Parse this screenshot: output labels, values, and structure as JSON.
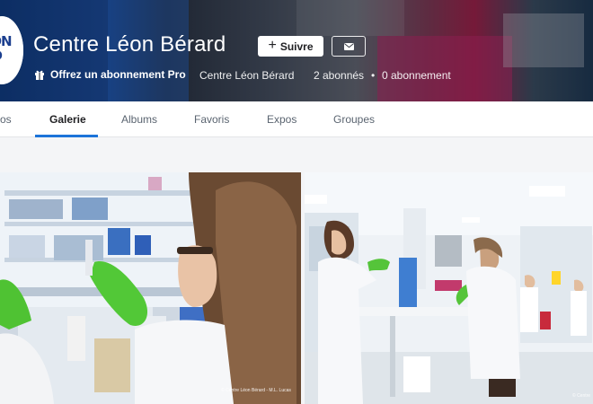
{
  "profile": {
    "avatar_text_line1": "EON",
    "avatar_text_line2": "RD",
    "title": "Centre Léon Bérard",
    "follow_label": "Suivre",
    "pro_label": "Offrez un abonnement Pro",
    "display_name": "Centre Léon Bérard",
    "followers": "2 abonnés",
    "separator": "•",
    "following": "0 abonnement"
  },
  "tabs": [
    {
      "label": "os"
    },
    {
      "label": "Galerie"
    },
    {
      "label": "Albums"
    },
    {
      "label": "Favoris"
    },
    {
      "label": "Expos"
    },
    {
      "label": "Groupes"
    }
  ],
  "active_tab": "Galerie",
  "photos": [
    {
      "credit": "© Centre Léon Bérard - M.L. Lucas",
      "icon": "lab-researcher-photo"
    },
    {
      "credit": "© Centre",
      "icon": "lab-team-photo"
    }
  ],
  "colors": {
    "accent": "#1c74d9",
    "text_dark": "#212124",
    "tab_text": "#5a6470"
  }
}
